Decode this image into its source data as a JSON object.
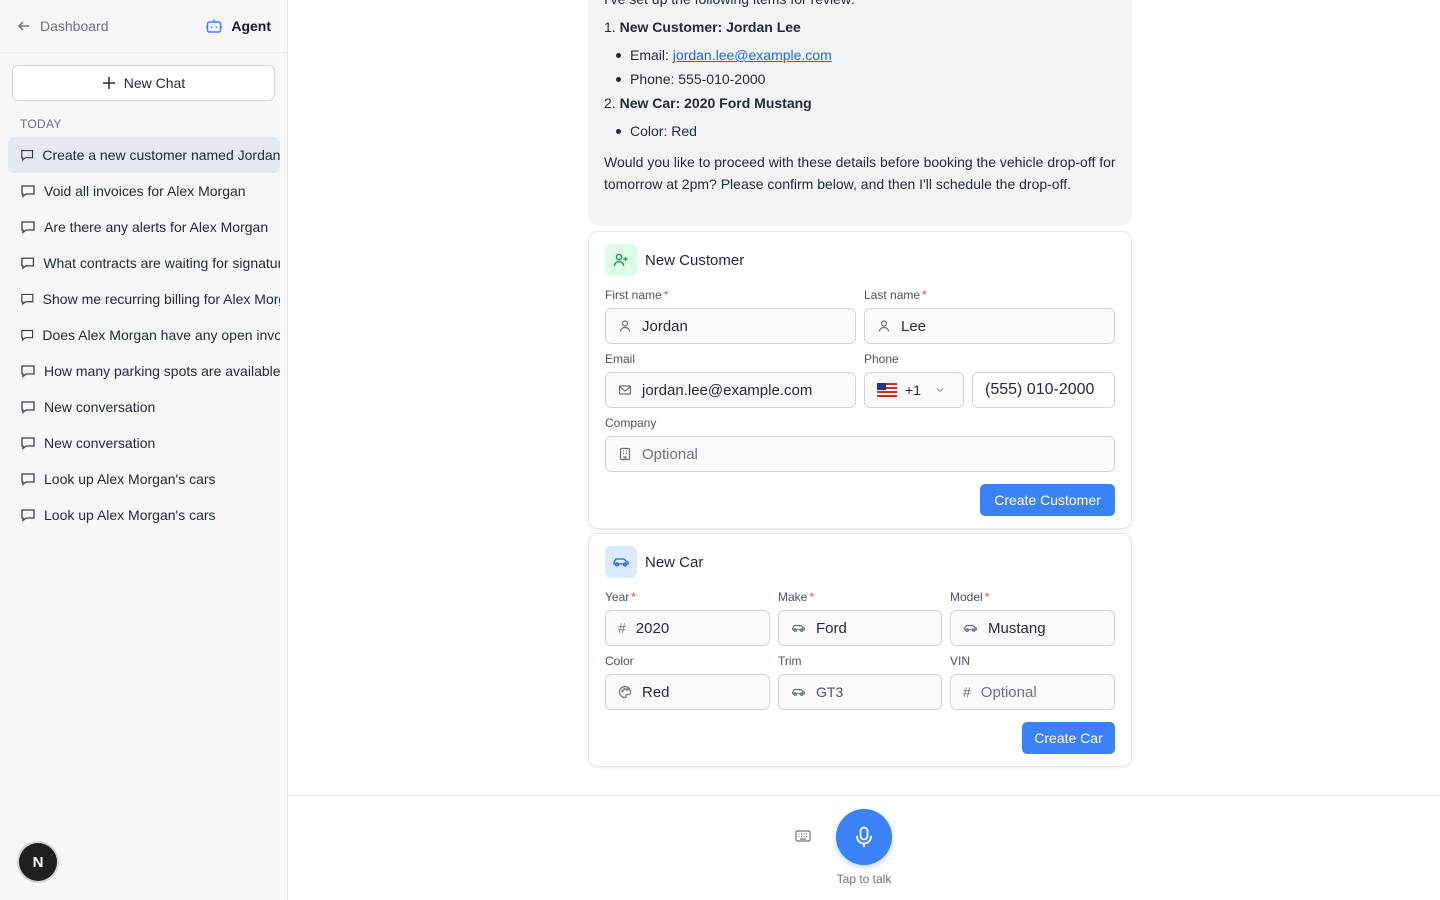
{
  "sidebar": {
    "back_label": "Dashboard",
    "agent_label": "Agent",
    "new_chat_label": "New Chat",
    "section_label": "TODAY",
    "items": [
      {
        "label": "Create a new customer named Jordan Lee"
      },
      {
        "label": "Void all invoices for Alex Morgan"
      },
      {
        "label": "Are there any alerts for Alex Morgan"
      },
      {
        "label": "What contracts are waiting for signature"
      },
      {
        "label": "Show me recurring billing for Alex Morgan"
      },
      {
        "label": "Does Alex Morgan have any open invoices"
      },
      {
        "label": "How many parking spots are available"
      },
      {
        "label": "New conversation"
      },
      {
        "label": "New conversation"
      },
      {
        "label": "Look up Alex Morgan's cars"
      },
      {
        "label": "Look up Alex Morgan's cars"
      }
    ],
    "user_initial": "N"
  },
  "message": {
    "intro": "I've set up the following items for review:",
    "item1_num": "1.",
    "item1_title": "New Customer: Jordan Lee",
    "email_label": "Email: ",
    "email_value": "jordan.lee@example.com",
    "phone_text": "Phone: 555-010-2000",
    "item2_num": "2.",
    "item2_title": "New Car: 2020 Ford Mustang",
    "color_text": "Color: Red",
    "closing": "Would you like to proceed with these details before booking the vehicle drop-off for tomorrow at 2pm? Please confirm below, and then I'll schedule the drop-off."
  },
  "customer_card": {
    "title": "New Customer",
    "first_name_label": "First name",
    "first_name_value": "Jordan",
    "last_name_label": "Last name",
    "last_name_value": "Lee",
    "email_label": "Email",
    "email_value": "jordan.lee@example.com",
    "phone_label": "Phone",
    "country_code": "+1",
    "phone_value": "(555) 010-2000",
    "company_label": "Company",
    "company_placeholder": "Optional",
    "submit_label": "Create Customer"
  },
  "car_card": {
    "title": "New Car",
    "year_label": "Year",
    "year_value": "2020",
    "make_label": "Make",
    "make_value": "Ford",
    "model_label": "Model",
    "model_value": "Mustang",
    "color_label": "Color",
    "color_value": "Red",
    "trim_label": "Trim",
    "trim_value": "GT3",
    "vin_label": "VIN",
    "vin_placeholder": "Optional",
    "submit_label": "Create Car"
  },
  "voice": {
    "tap_label": "Tap to talk"
  },
  "colors": {
    "accent": "#3b82f6",
    "required": "#ef4444",
    "link": "#2563eb"
  },
  "required_mark": "*"
}
